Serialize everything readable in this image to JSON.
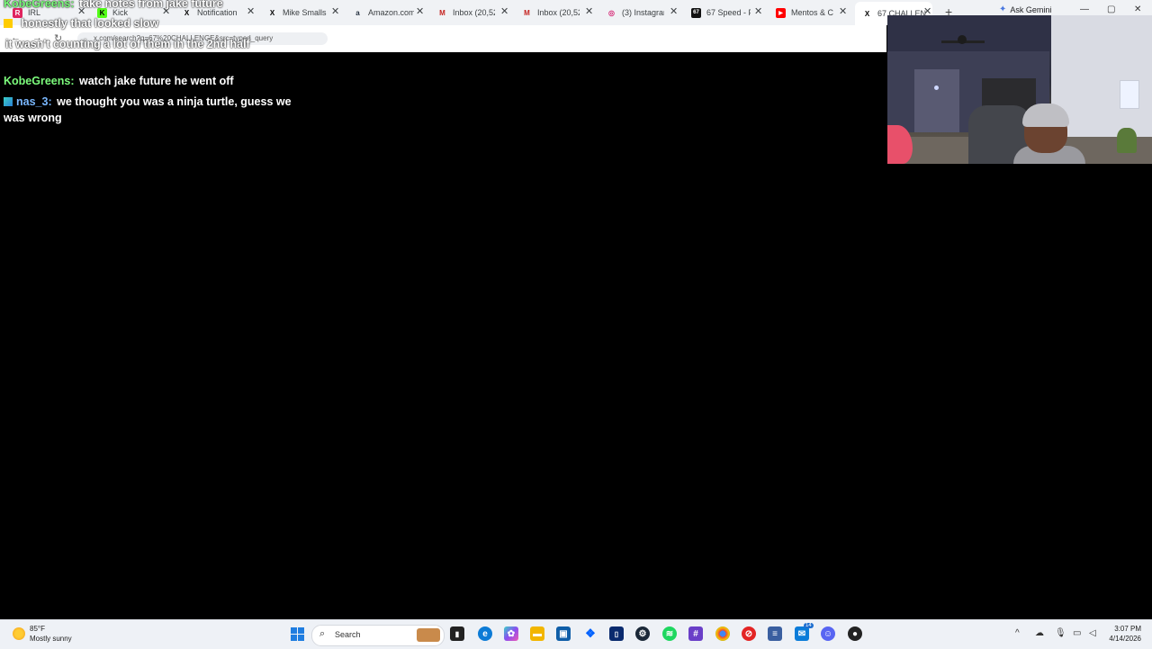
{
  "browser": {
    "tabs": [
      {
        "label": "IRL",
        "icon": "R",
        "color": "#e0245e",
        "active": false
      },
      {
        "label": "Kick",
        "icon": "K",
        "color": "#2d2d2d",
        "active": false
      },
      {
        "label": "Notification",
        "icon": "X",
        "color": "#000000",
        "active": false
      },
      {
        "label": "Mike Smalls",
        "icon": "X",
        "color": "#000000",
        "active": false
      },
      {
        "label": "Amazon.com",
        "icon": "a",
        "color": "#232f3e",
        "active": false
      },
      {
        "label": "Inbox (20,52",
        "icon": "M",
        "color": "#c5221f",
        "active": false
      },
      {
        "label": "Inbox (20,52",
        "icon": "M",
        "color": "#c5221f",
        "active": false
      },
      {
        "label": "(3) Instagram",
        "icon": "◎",
        "color": "#d62976",
        "active": false
      },
      {
        "label": "67 Speed - F",
        "icon": "67",
        "color": "#111111",
        "active": false
      },
      {
        "label": "Mentos & Co",
        "icon": "▶",
        "color": "#ff0000",
        "active": false
      },
      {
        "label": "67 CHALLEN",
        "icon": "X",
        "color": "#000000",
        "active": true
      }
    ],
    "new_tab": "+",
    "ask_gemini": "Ask Gemini",
    "url": "x.com/search?q=67%20CHALLENGE&src=typed_query"
  },
  "chat": {
    "messages": [
      {
        "user": "KobeGreens:",
        "user_color": "#7cfc7c",
        "text": "take notes from jake future",
        "faded": false
      },
      {
        "user": "",
        "user_color": "#ff9a3c",
        "text": "honestly that looked slow",
        "faded": false
      },
      {
        "user": "",
        "user_color": "#ffb347",
        "text": "it wasn't counting a lot of them in the 2nd half",
        "faded": false
      },
      {
        "user": "KobeGreens:",
        "user_color": "#7cfc7c",
        "text": "watch jake future he went off",
        "faded": false
      },
      {
        "user": "nas_3:",
        "user_color": "#7ab8ff",
        "text": "we thought you was a ninja turtle, guess we was wrong",
        "faded": false
      }
    ]
  },
  "taskbar": {
    "weather": {
      "temp": "85°F",
      "condition": "Mostly sunny"
    },
    "search_label": "Search",
    "clock": {
      "time": "3:07 PM",
      "date": "4/14/2026"
    },
    "badges": {
      "messenger": "14"
    }
  }
}
